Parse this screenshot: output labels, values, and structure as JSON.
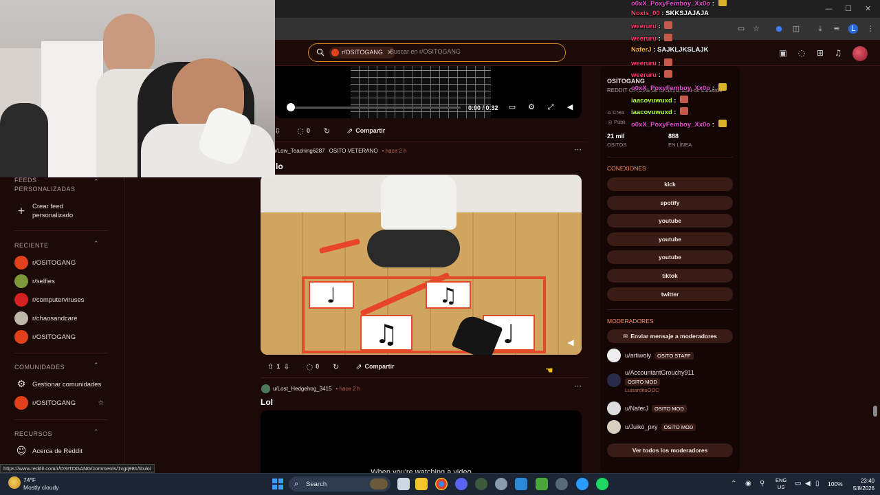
{
  "browser": {
    "window_controls": [
      "—",
      "☐",
      "✕"
    ],
    "nav_icons": [
      "screen-icon",
      "star-icon",
      "extension-icon",
      "puzzle-icon",
      "download-icon",
      "list-icon",
      "profile-icon",
      "menu-icon"
    ]
  },
  "header": {
    "search_chip": "r/OSITOGANG",
    "search_chip_close": "✕",
    "search_placeholder": "Buscar en r/OSITOGANG"
  },
  "video_top": {
    "time": "0:00 / 0:32",
    "progress": 0.0
  },
  "posts": [
    {
      "votes": "1",
      "comments": "0",
      "share_label": "Compartir"
    },
    {
      "author": "u/Low_Teaching6287",
      "flair": "OSITO VETERANO",
      "time_ago": "• hace 2 h",
      "title": "lo",
      "votes": "1",
      "comments": "0",
      "share_label": "Compartir"
    },
    {
      "author": "u/Lost_Hedgehog_3415",
      "time_ago": "• hace 2 h",
      "title": "Lol",
      "video_caption": "When you're watching a video"
    }
  ],
  "sidebar": {
    "custom_feeds_heading": "FEEDS PERSONALIZADAS",
    "create_feed": "Crear feed personalizado",
    "recent_heading": "RECIENTE",
    "recent": [
      {
        "label": "r/OSITOGANG",
        "color": "#e0401a"
      },
      {
        "label": "r/selfies",
        "color": "#7a9a3a"
      },
      {
        "label": "r/computerviruses",
        "color": "#d42020"
      },
      {
        "label": "r/chaosandcare",
        "color": "#bfb7a8"
      },
      {
        "label": "r/OSITOGANG",
        "color": "#e0401a"
      }
    ],
    "communities_heading": "COMUNIDADES",
    "manage_communities": "Gestionar comunidades",
    "community": "r/OSITOGANG",
    "resources_heading": "RECURSOS",
    "about": "Acerca de Reddit"
  },
  "right_sidebar": {
    "name": "OSITOGANG",
    "description": "REDDIT OFICIAL de la comunidad de Luisardit",
    "created_label": "Crea",
    "public_label": "Públi",
    "members_count": "21 mil",
    "members_label": "OSITOS",
    "online_count": "888",
    "online_label": "EN LÍNEA",
    "connections_heading": "CONEXIONES",
    "connections": [
      "kick",
      "spotify",
      "youtube",
      "youtube",
      "youtube",
      "tiktok",
      "twitter"
    ],
    "moderators_heading": "MODERADORES",
    "message_mods": "Enviar mensaje a moderadores",
    "moderators": [
      {
        "name": "u/artiwoly",
        "flair": "OSITO STAFF",
        "sub": ""
      },
      {
        "name": "u/AccountantGrouchy911",
        "flair": "OSITO MOD",
        "sub": "LuisarditoOOC"
      },
      {
        "name": "u/NaferJ",
        "flair": "OSITO MOD",
        "sub": ""
      },
      {
        "name": "u/Juiko_pxy",
        "flair": "OSITO MOD",
        "sub": ""
      }
    ],
    "view_all_mods": "Ver todos los moderadores"
  },
  "chat": [
    {
      "user": "o0xX_PoxyFemboy_Xx0o",
      "msg": "",
      "color": "#e84ad0",
      "emote": "yellow"
    },
    {
      "user": "Noxis_00",
      "msg": "SKKSJAJAJA",
      "color": "#ff3a6a",
      "emote": ""
    },
    {
      "user": "weeruru",
      "msg": "",
      "color": "#ff3a6a",
      "emote": "red"
    },
    {
      "user": "weeruru",
      "msg": "",
      "color": "#ff3a6a",
      "emote": "red"
    },
    {
      "user": "NaferJ",
      "msg": "SAJKLJKSLAJK",
      "color": "#f2a72a",
      "emote": ""
    },
    {
      "user": "weeruru",
      "msg": "",
      "color": "#ff3a6a",
      "emote": "red"
    },
    {
      "user": "weeruru",
      "msg": "",
      "color": "#ff3a6a",
      "emote": "red"
    },
    {
      "user": "o0xX_PoxyFemboy_Xx0o",
      "msg": "",
      "color": "#e84ad0",
      "emote": "yellow"
    },
    {
      "user": "iaacovuwuxd",
      "msg": "",
      "color": "#b8ff3a",
      "emote": "red"
    },
    {
      "user": "iaacovuwuxd",
      "msg": "",
      "color": "#b8ff3a",
      "emote": "red"
    },
    {
      "user": "o0xX_PoxyFemboy_Xx0o",
      "msg": "",
      "color": "#e84ad0",
      "emote": "yellow"
    }
  ],
  "status_url": "https://www.reddit.com/r/OSITOGANG/comments/1vgq981/titulo/",
  "taskbar": {
    "temp": "74°F",
    "condition": "Mostly cloudy",
    "search_label": "Search",
    "lang_line1": "ENG",
    "lang_line2": "US",
    "battery": "100%",
    "time": "23:40",
    "date": "5/8/2026"
  }
}
